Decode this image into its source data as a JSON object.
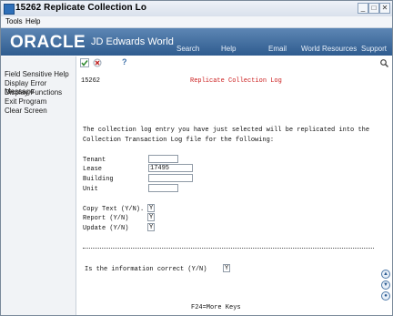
{
  "window": {
    "title": "15262    Replicate Collection Lo",
    "controls": [
      "_",
      "□",
      "✕"
    ]
  },
  "menu": [
    "Tools",
    "Help"
  ],
  "banner": {
    "logo": "ORACLE",
    "product": "JD Edwards World",
    "nav": [
      "Search",
      "Help",
      "Email",
      "World Resources",
      "Support"
    ]
  },
  "toolbar": {
    "icons": [
      "check-icon",
      "cancel-icon",
      "help-icon",
      "magnifier-icon"
    ],
    "help_glyph": "?"
  },
  "sidebar": {
    "items": [
      "Field Sensitive Help",
      "Display Error Message",
      "Display Functions",
      "Exit Program",
      "Clear Screen"
    ]
  },
  "screen": {
    "program_id": "15262",
    "heading": "Replicate Collection Log",
    "intro_line1": "The collection log entry you have just selected will be replicated into the",
    "intro_line2": "Collection Transaction Log file for the following:",
    "fields": [
      {
        "label": "Tenant",
        "value": ""
      },
      {
        "label": "Lease",
        "value": "17495"
      },
      {
        "label": "Building",
        "value": ""
      },
      {
        "label": "Unit",
        "value": ""
      }
    ],
    "options": [
      {
        "label": "Copy Text (Y/N).",
        "value": "Y"
      },
      {
        "label": "Report (Y/N)",
        "value": "Y"
      },
      {
        "label": "Update (Y/N)",
        "value": "Y"
      }
    ],
    "confirm_label": "Is the information correct (Y/N)",
    "confirm_value": "Y",
    "function_keys": "F24=More Keys"
  },
  "colors": {
    "banner": "#2f5c8f",
    "heading_red": "#cc1f1f",
    "check_green": "#2f8a2f",
    "cancel_red": "#c02525"
  }
}
